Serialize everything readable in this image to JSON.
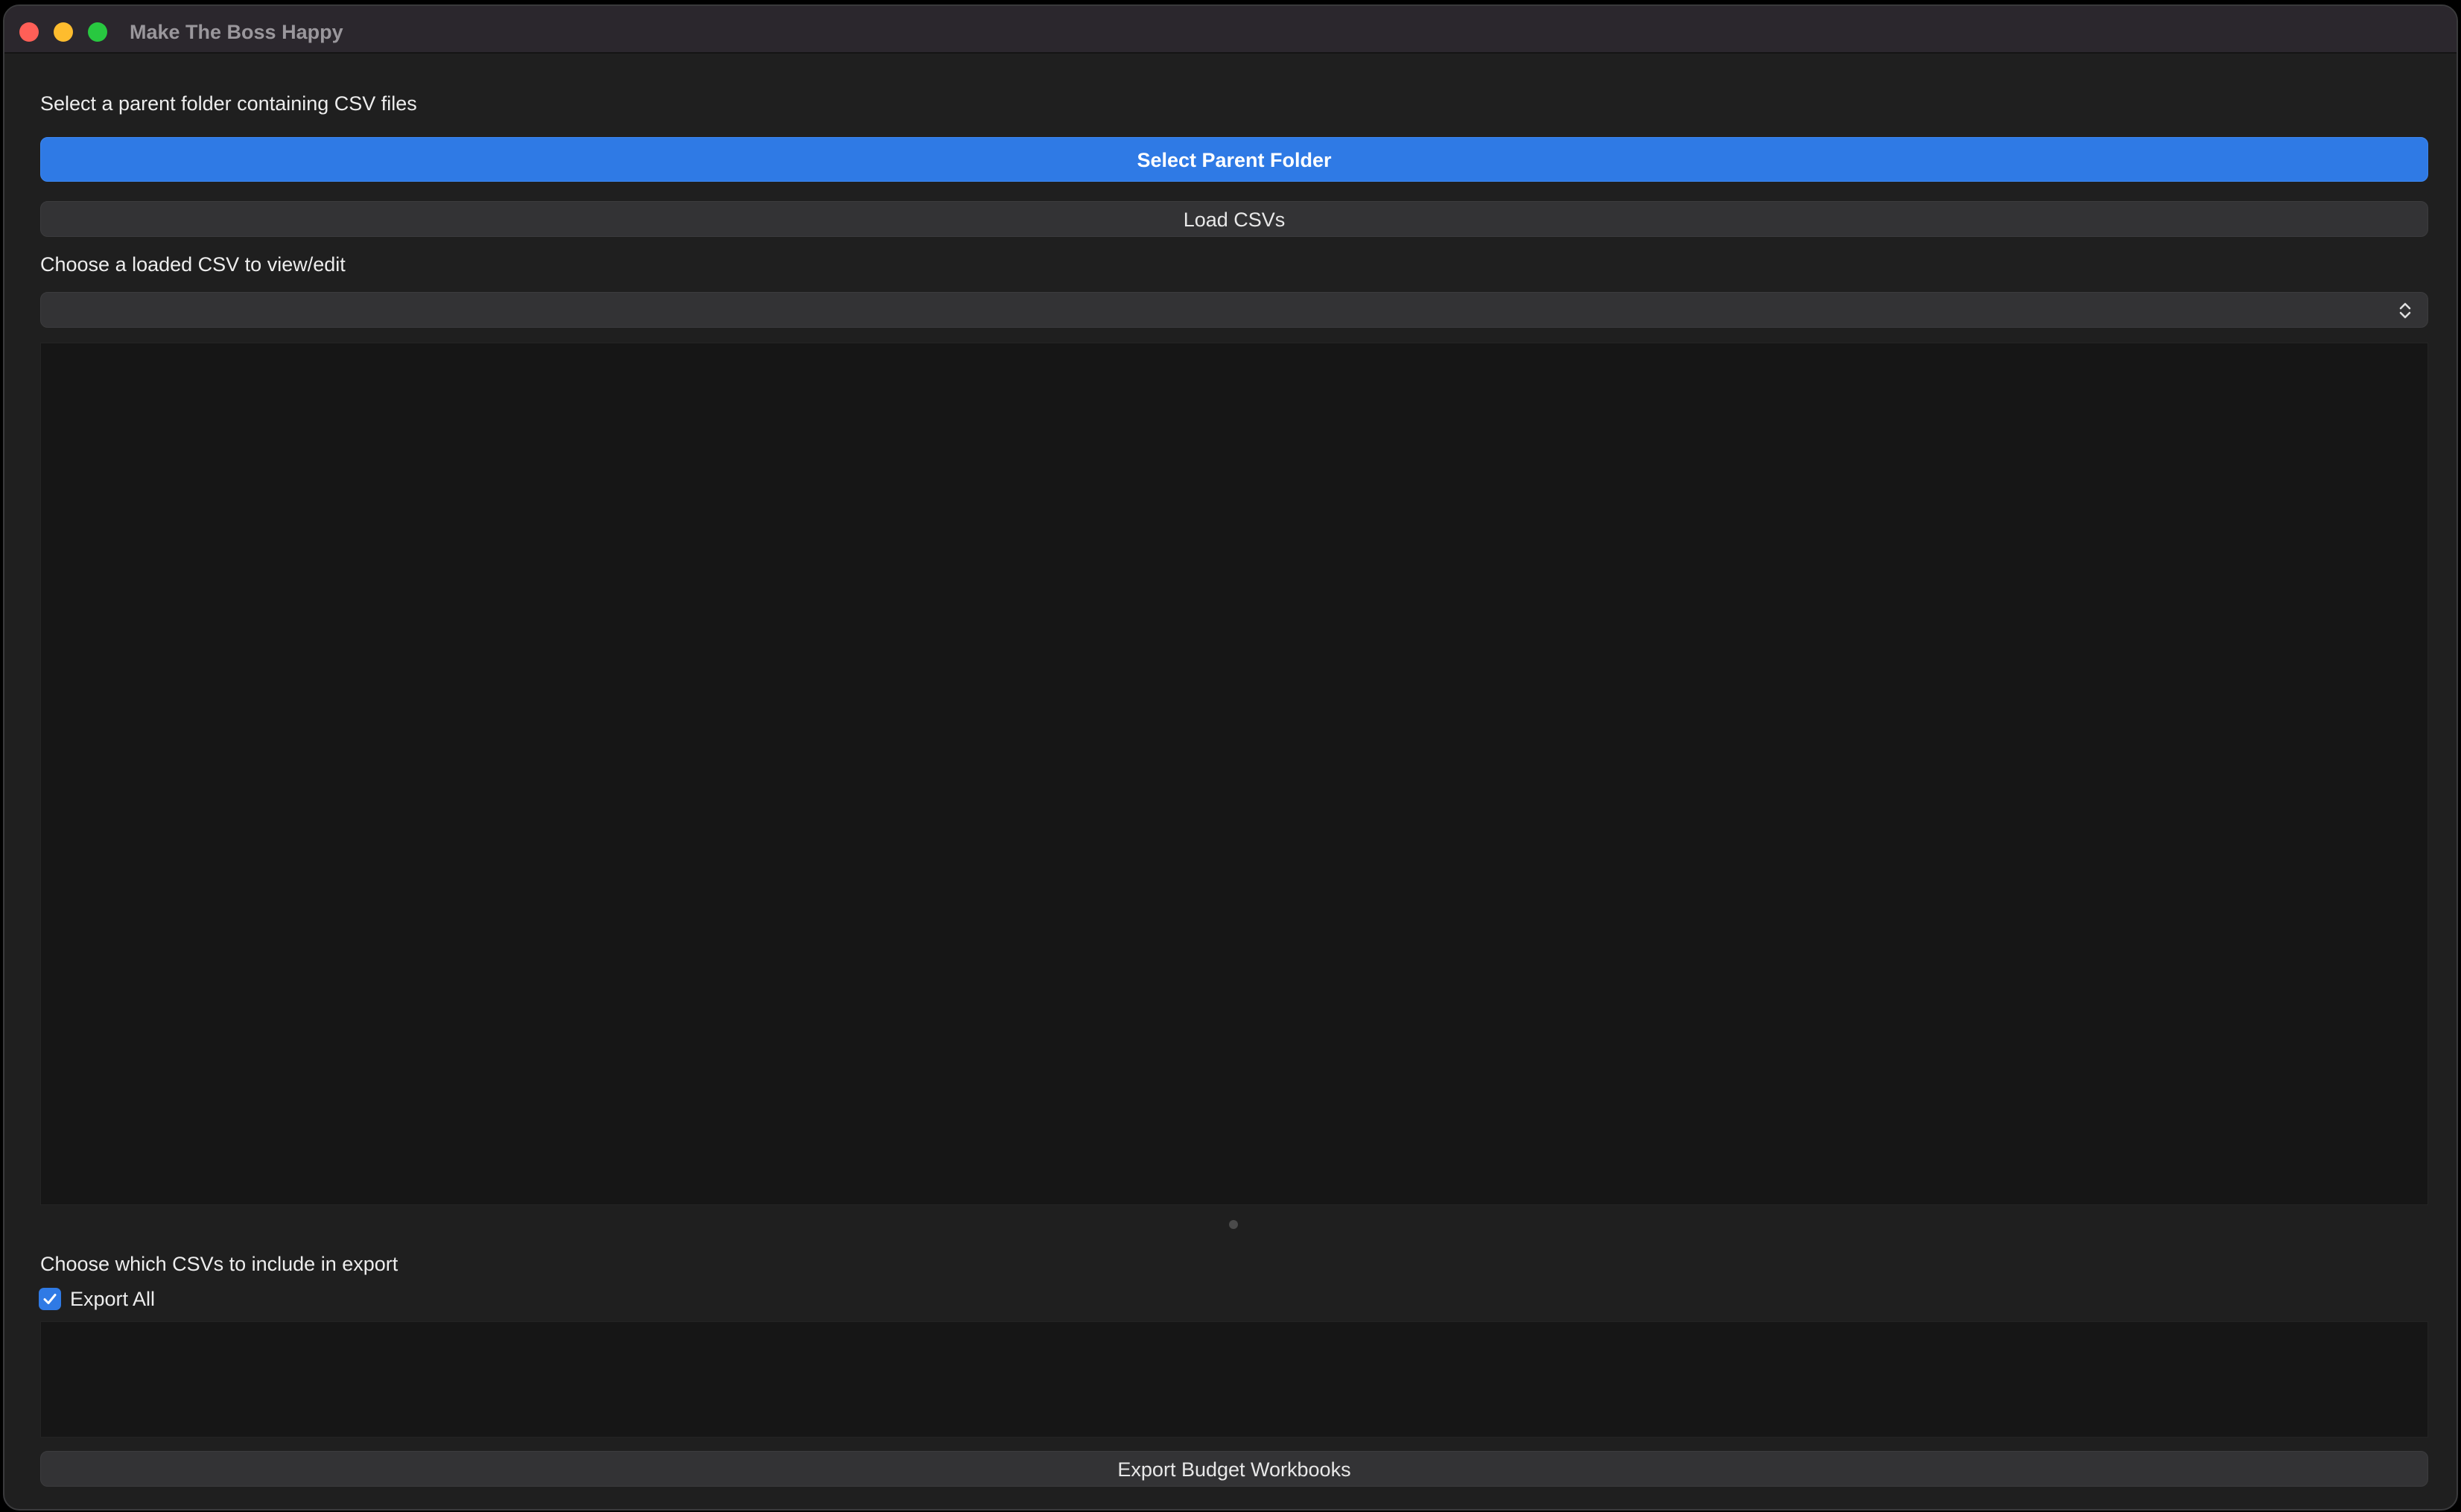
{
  "window": {
    "title": "Make The Boss Happy"
  },
  "folder_section": {
    "label": "Select a parent folder containing CSV files",
    "select_button": "Select Parent Folder",
    "load_button": "Load CSVs"
  },
  "viewer_section": {
    "label": "Choose a loaded CSV to view/edit",
    "selected_csv": ""
  },
  "export_section": {
    "label": "Choose which CSVs to include in export",
    "export_all_label": "Export All",
    "export_all_checked": true,
    "export_button": "Export Budget Workbooks"
  },
  "colors": {
    "accent": "#2f7ae5",
    "window_bg": "#1f1f1f",
    "titlebar_bg": "#2b272d"
  },
  "icons": {
    "close": "close-window-icon",
    "minimize": "minimize-window-icon",
    "maximize": "maximize-window-icon",
    "select_arrows": "chevron-up-down-icon",
    "check": "checkmark-icon"
  }
}
